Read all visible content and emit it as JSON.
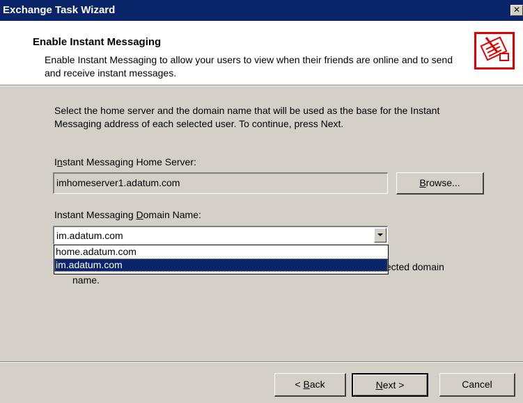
{
  "window": {
    "title": "Exchange Task Wizard",
    "close_glyph": "✕"
  },
  "header": {
    "title": "Enable Instant Messaging",
    "description": "Enable Instant Messaging to allow your users to view when their friends are online and to send and receive instant messages.",
    "icon": "wizard-task-icon"
  },
  "body": {
    "instructions": "Select the home server and the domain name that will be used as the base for the Instant Messaging address of each selected user. To continue, press Next.",
    "home_server": {
      "label_pre": "I",
      "label_underlined": "n",
      "label_post": "stant Messaging Home Server:",
      "value": "imhomeserver1.adatum.com"
    },
    "browse": {
      "label_underlined": "B",
      "label_post": "rowse..."
    },
    "domain": {
      "label_pre": "Instant Messaging ",
      "label_underlined": "D",
      "label_post": "omain Name:",
      "value": "im.adatum.com",
      "options": [
        "home.adatum.com",
        "im.adatum.com"
      ],
      "selected_index": 1
    },
    "partially_hidden_text": "Users will be enabled for Instant Messaging and addressed using the selected domain name."
  },
  "footer": {
    "back": {
      "prefix": "< ",
      "underlined": "B",
      "rest": "ack"
    },
    "next": {
      "underlined": "N",
      "rest": "ext >"
    },
    "cancel": "Cancel"
  },
  "colors": {
    "titlebar": "#0a246a",
    "dialog_face": "#d4d0c8",
    "highlight": "#0a246a",
    "icon_accent": "#e00000"
  }
}
